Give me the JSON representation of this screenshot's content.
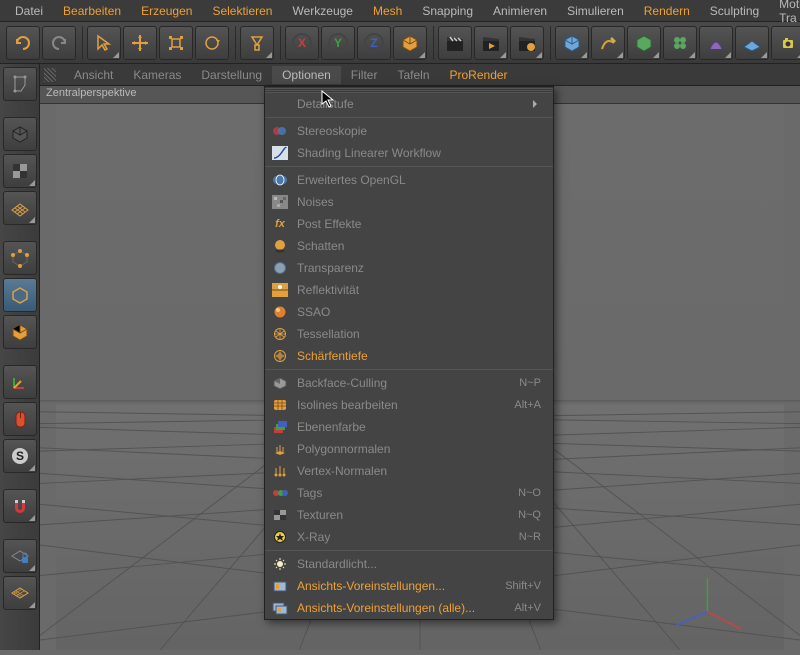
{
  "main_menu": {
    "items": [
      {
        "label": "Datei",
        "orange": false
      },
      {
        "label": "Bearbeiten",
        "orange": true
      },
      {
        "label": "Erzeugen",
        "orange": true
      },
      {
        "label": "Selektieren",
        "orange": true
      },
      {
        "label": "Werkzeuge",
        "orange": false
      },
      {
        "label": "Mesh",
        "orange": true
      },
      {
        "label": "Snapping",
        "orange": false
      },
      {
        "label": "Animieren",
        "orange": false
      },
      {
        "label": "Simulieren",
        "orange": false
      },
      {
        "label": "Rendern",
        "orange": true
      },
      {
        "label": "Sculpting",
        "orange": false
      },
      {
        "label": "Motion Tra",
        "orange": false
      }
    ]
  },
  "view_menu": {
    "items": [
      {
        "label": "Ansicht"
      },
      {
        "label": "Kameras"
      },
      {
        "label": "Darstellung"
      },
      {
        "label": "Optionen",
        "active": true
      },
      {
        "label": "Filter"
      },
      {
        "label": "Tafeln"
      },
      {
        "label": "ProRender",
        "orange": true
      }
    ],
    "title": "Zentralperspektive"
  },
  "dropdown": {
    "groups": [
      [
        {
          "label": "Detailstufe",
          "icon": "blank",
          "submenu": true
        }
      ],
      [
        {
          "label": "Stereoskopie",
          "icon": "stereo"
        },
        {
          "label": "Shading Linearer Workflow",
          "icon": "curve"
        }
      ],
      [
        {
          "label": "Erweitertes OpenGL",
          "icon": "ogl"
        },
        {
          "label": "Noises",
          "icon": "noise"
        },
        {
          "label": "Post Effekte",
          "icon": "fx"
        },
        {
          "label": "Schatten",
          "icon": "sphere-dark"
        },
        {
          "label": "Transparenz",
          "icon": "sphere-glass"
        },
        {
          "label": "Reflektivität",
          "icon": "refl"
        },
        {
          "label": "SSAO",
          "icon": "sphere-orange"
        },
        {
          "label": "Tessellation",
          "icon": "tess"
        },
        {
          "label": "Schärfentiefe",
          "icon": "aperture",
          "orange": true
        }
      ],
      [
        {
          "label": "Backface-Culling",
          "icon": "cube-half",
          "shortcut": "N~P"
        },
        {
          "label": "Isolines bearbeiten",
          "icon": "iso",
          "shortcut": "Alt+A"
        },
        {
          "label": "Ebenenfarbe",
          "icon": "layers"
        },
        {
          "label": "Polygonnormalen",
          "icon": "normals"
        },
        {
          "label": "Vertex-Normalen",
          "icon": "vnormals"
        },
        {
          "label": "Tags",
          "icon": "tags",
          "shortcut": "N~O"
        },
        {
          "label": "Texturen",
          "icon": "tex",
          "shortcut": "N~Q"
        },
        {
          "label": "X-Ray",
          "icon": "xray",
          "shortcut": "N~R"
        }
      ],
      [
        {
          "label": "Standardlicht...",
          "icon": "light"
        },
        {
          "label": "Ansichts-Voreinstellungen...",
          "icon": "pref",
          "shortcut": "Shift+V",
          "orange": true
        },
        {
          "label": "Ansichts-Voreinstellungen (alle)...",
          "icon": "pref-all",
          "shortcut": "Alt+V",
          "orange": true
        }
      ]
    ]
  },
  "axis_letters": {
    "x": "X",
    "y": "Y",
    "z": "Z"
  }
}
